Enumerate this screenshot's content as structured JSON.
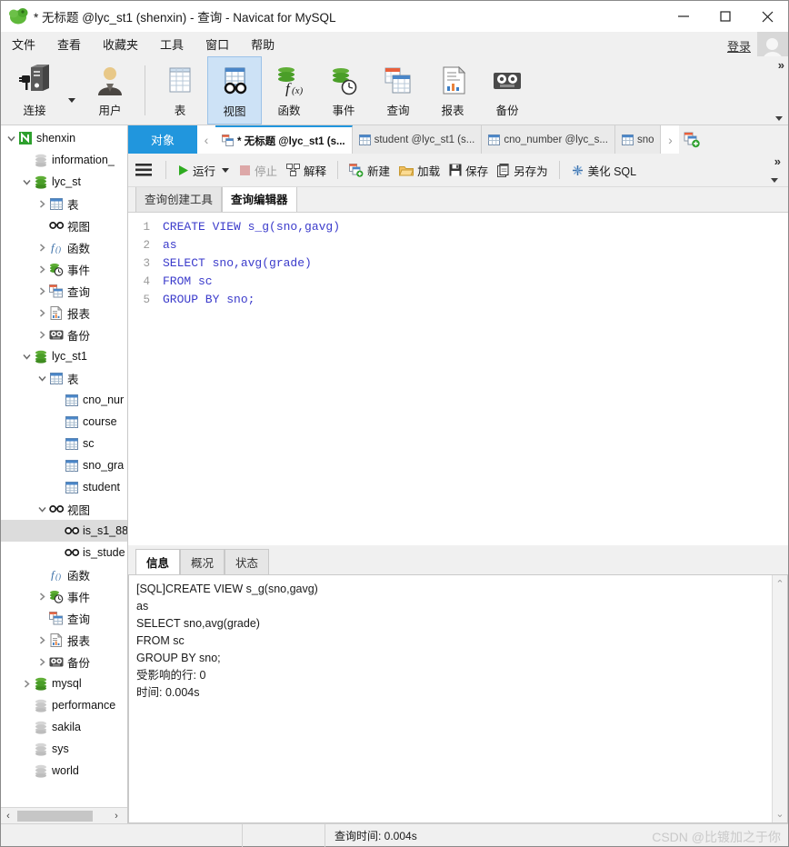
{
  "window": {
    "title": "* 无标题 @lyc_st1 (shenxin) - 查询 - Navicat for MySQL",
    "app_icon": "navicat-logo-icon",
    "minimize": "minimize-icon",
    "maximize": "maximize-icon",
    "close": "close-icon"
  },
  "menubar": {
    "items": [
      {
        "label": "文件"
      },
      {
        "label": "查看"
      },
      {
        "label": "收藏夹"
      },
      {
        "label": "工具"
      },
      {
        "label": "窗口"
      },
      {
        "label": "帮助"
      }
    ],
    "login_label": "登录",
    "avatar": "user-avatar-icon"
  },
  "ribbon": {
    "overflow_chevrons": "»",
    "groups": [
      {
        "buttons": [
          {
            "label": "连接",
            "icon": "connection-icon",
            "active": false,
            "has_caret": true
          },
          {
            "label": "用户",
            "icon": "user-icon",
            "active": false,
            "has_caret": false
          }
        ]
      },
      {
        "buttons": [
          {
            "label": "表",
            "icon": "table-icon",
            "active": false,
            "has_caret": false
          },
          {
            "label": "视图",
            "icon": "view-glasses-icon",
            "active": true,
            "has_caret": false
          },
          {
            "label": "函数",
            "icon": "function-icon",
            "active": false,
            "has_caret": false
          },
          {
            "label": "事件",
            "icon": "event-clock-icon",
            "active": false,
            "has_caret": false
          },
          {
            "label": "查询",
            "icon": "query-icon",
            "active": false,
            "has_caret": false
          },
          {
            "label": "报表",
            "icon": "report-icon",
            "active": false,
            "has_caret": false
          },
          {
            "label": "备份",
            "icon": "backup-tape-icon",
            "active": false,
            "has_caret": false
          }
        ]
      }
    ]
  },
  "sidebar": {
    "tree": [
      {
        "label": "shenxin",
        "indent": 0,
        "twist": "down",
        "icon": "navicat-connection-icon"
      },
      {
        "label": "information_",
        "indent": 1,
        "twist": "none",
        "icon": "database-gray-icon"
      },
      {
        "label": "lyc_st",
        "indent": 1,
        "twist": "down",
        "icon": "database-green-icon"
      },
      {
        "label": "表",
        "indent": 2,
        "twist": "right",
        "icon": "table-icon"
      },
      {
        "label": "视图",
        "indent": 2,
        "twist": "none",
        "icon": "view-glasses-icon"
      },
      {
        "label": "函数",
        "indent": 2,
        "twist": "right",
        "icon": "function-icon"
      },
      {
        "label": "事件",
        "indent": 2,
        "twist": "right",
        "icon": "event-clock-icon"
      },
      {
        "label": "查询",
        "indent": 2,
        "twist": "right",
        "icon": "query-icon"
      },
      {
        "label": "报表",
        "indent": 2,
        "twist": "right",
        "icon": "report-icon"
      },
      {
        "label": "备份",
        "indent": 2,
        "twist": "right",
        "icon": "backup-tape-icon"
      },
      {
        "label": "lyc_st1",
        "indent": 1,
        "twist": "down",
        "icon": "database-green-icon"
      },
      {
        "label": "表",
        "indent": 2,
        "twist": "down",
        "icon": "table-icon"
      },
      {
        "label": "cno_nur",
        "indent": 3,
        "twist": "none",
        "icon": "table-icon"
      },
      {
        "label": "course",
        "indent": 3,
        "twist": "none",
        "icon": "table-icon"
      },
      {
        "label": "sc",
        "indent": 3,
        "twist": "none",
        "icon": "table-icon"
      },
      {
        "label": "sno_gra",
        "indent": 3,
        "twist": "none",
        "icon": "table-icon"
      },
      {
        "label": "student",
        "indent": 3,
        "twist": "none",
        "icon": "table-icon"
      },
      {
        "label": "视图",
        "indent": 2,
        "twist": "down",
        "icon": "view-glasses-icon"
      },
      {
        "label": "is_s1_88",
        "indent": 3,
        "twist": "none",
        "icon": "view-glasses-icon",
        "selected": true
      },
      {
        "label": "is_stude",
        "indent": 3,
        "twist": "none",
        "icon": "view-glasses-icon"
      },
      {
        "label": "函数",
        "indent": 2,
        "twist": "none",
        "icon": "function-icon"
      },
      {
        "label": "事件",
        "indent": 2,
        "twist": "right",
        "icon": "event-clock-icon"
      },
      {
        "label": "查询",
        "indent": 2,
        "twist": "none",
        "icon": "query-icon"
      },
      {
        "label": "报表",
        "indent": 2,
        "twist": "right",
        "icon": "report-icon"
      },
      {
        "label": "备份",
        "indent": 2,
        "twist": "right",
        "icon": "backup-tape-icon"
      },
      {
        "label": "mysql",
        "indent": 1,
        "twist": "right",
        "icon": "database-green-icon"
      },
      {
        "label": "performance",
        "indent": 1,
        "twist": "none",
        "icon": "database-gray-icon"
      },
      {
        "label": "sakila",
        "indent": 1,
        "twist": "none",
        "icon": "database-gray-icon"
      },
      {
        "label": "sys",
        "indent": 1,
        "twist": "none",
        "icon": "database-gray-icon"
      },
      {
        "label": "world",
        "indent": 1,
        "twist": "none",
        "icon": "database-gray-icon"
      }
    ],
    "hscroll": {
      "left_arrow": "‹",
      "right_arrow": "›"
    }
  },
  "tabstrip": {
    "object_tab": "对象",
    "nav_prev": "‹",
    "nav_next": "›",
    "add_tab_icon": "new-query-tab-icon",
    "tabs": [
      {
        "label": "* 无标题 @lyc_st1 (s...",
        "icon": "query-icon",
        "active": true
      },
      {
        "label": "student @lyc_st1 (s...",
        "icon": "table-icon",
        "active": false
      },
      {
        "label": "cno_number @lyc_s...",
        "icon": "table-icon",
        "active": false
      },
      {
        "label": "sno",
        "icon": "table-icon",
        "active": false
      }
    ]
  },
  "query_toolbar": {
    "burger_icon": "menu-burger-icon",
    "buttons": [
      {
        "label": "运行",
        "icon": "run-play-icon",
        "disabled": false,
        "caret": true
      },
      {
        "label": "停止",
        "icon": "stop-square-icon",
        "disabled": true,
        "caret": false
      },
      {
        "label": "解释",
        "icon": "explain-icon",
        "disabled": false,
        "caret": false
      },
      {
        "label": "新建",
        "icon": "new-file-icon",
        "disabled": false,
        "caret": false
      },
      {
        "label": "加载",
        "icon": "folder-open-icon",
        "disabled": false,
        "caret": false
      },
      {
        "label": "保存",
        "icon": "save-disk-icon",
        "disabled": false,
        "caret": false
      },
      {
        "label": "另存为",
        "icon": "save-as-icon",
        "disabled": false,
        "caret": false
      },
      {
        "label": "美化 SQL",
        "icon": "beautify-sql-icon",
        "disabled": false,
        "caret": false
      }
    ],
    "overflow_chevrons": "»"
  },
  "editor": {
    "subtabs": [
      {
        "label": "查询创建工具",
        "active": false
      },
      {
        "label": "查询编辑器",
        "active": true
      }
    ],
    "lines": [
      {
        "no": "1",
        "text": "CREATE VIEW s_g(sno,gavg)"
      },
      {
        "no": "2",
        "text": "as"
      },
      {
        "no": "3",
        "text": "SELECT sno,avg(grade)"
      },
      {
        "no": "4",
        "text": "FROM sc"
      },
      {
        "no": "5",
        "text": "GROUP BY sno;"
      }
    ],
    "sql_color": "#3b3bcb"
  },
  "info_panel": {
    "tabs": [
      {
        "label": "信息",
        "active": true
      },
      {
        "label": "概况",
        "active": false
      },
      {
        "label": "状态",
        "active": false
      }
    ],
    "lines": [
      "[SQL]CREATE VIEW s_g(sno,gavg)",
      "as",
      "SELECT sno,avg(grade)",
      "FROM sc",
      "GROUP BY sno;",
      "受影响的行: 0",
      "时间: 0.004s"
    ],
    "scroll_up": "⌃",
    "scroll_down": "⌄"
  },
  "statusbar": {
    "query_time_label": "查询时间: 0.004s",
    "watermark": "CSDN @比镀加之于你"
  },
  "colors": {
    "accent_blue": "#2196dd",
    "ribbon_active": "#cde2f6",
    "db_green": "#4a9e28",
    "table_blue": "#4a86c8",
    "sql_blue": "#3b3bcb",
    "tree_select": "#dcdcdc",
    "chrome": "#f0f0f0"
  }
}
